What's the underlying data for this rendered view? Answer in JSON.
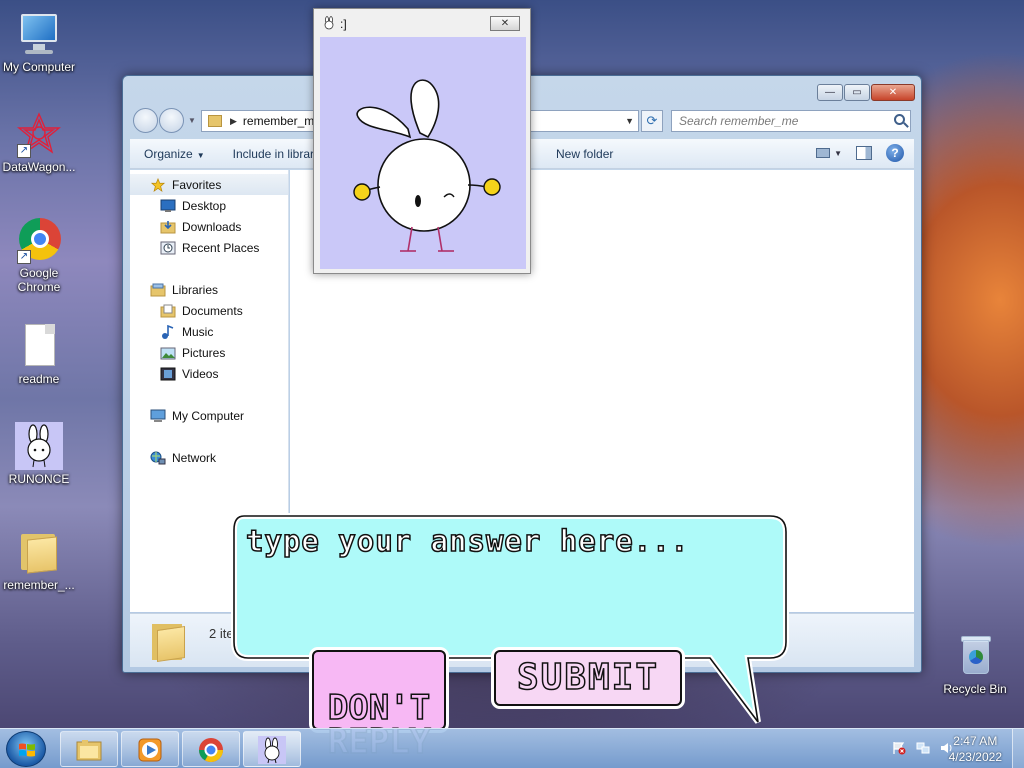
{
  "desktop": {
    "icons": [
      {
        "label": "My Computer"
      },
      {
        "label": "DataWagon..."
      },
      {
        "label": "Google Chrome"
      },
      {
        "label": "readme"
      },
      {
        "label": "RUNONCE"
      },
      {
        "label": "remember_..."
      },
      {
        "label": "Recycle Bin"
      }
    ]
  },
  "explorer": {
    "address": "remember_me",
    "search_placeholder": "Search remember_me",
    "controls": {
      "minimize": "—",
      "maximize": "▭",
      "close": "✕"
    },
    "commands": {
      "organize": "Organize",
      "include": "Include in library",
      "new_folder": "New folder"
    },
    "nav": {
      "favorites": "Favorites",
      "desktop": "Desktop",
      "downloads": "Downloads",
      "recent": "Recent Places",
      "libraries": "Libraries",
      "documents": "Documents",
      "music": "Music",
      "pictures": "Pictures",
      "videos": "Videos",
      "computer": "My Computer",
      "network": "Network"
    },
    "status": "2 items"
  },
  "popup": {
    "title": ":]",
    "close": "✕",
    "bg_color": "#cac8f8"
  },
  "dialog": {
    "placeholder": "type your answer here...",
    "dont_reply": "DON'T REPLY",
    "submit": "SUBMIT",
    "bubble_color": "#aefaf9"
  },
  "taskbar": {
    "time": "2:47 AM",
    "date": "4/23/2022"
  }
}
